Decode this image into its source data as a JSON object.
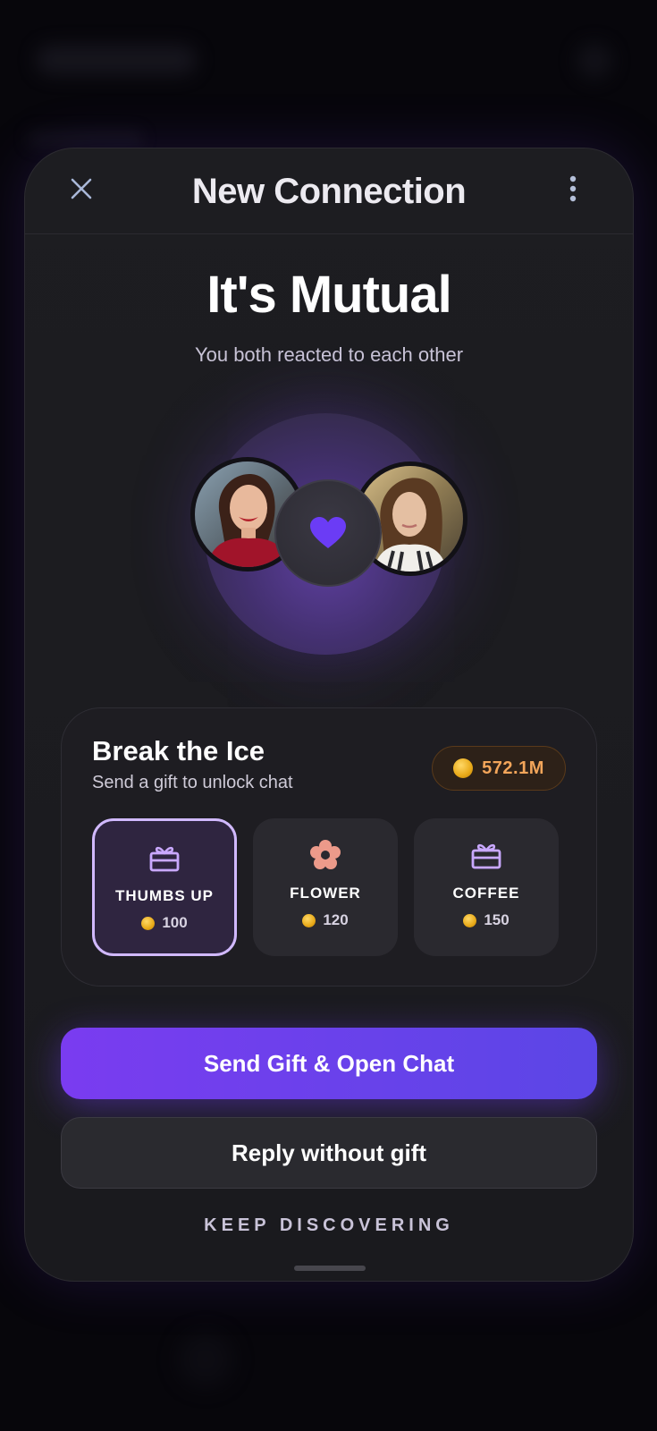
{
  "header": {
    "title": "New Connection"
  },
  "hero": {
    "title": "It's Mutual",
    "subtitle": "You both reacted to each other"
  },
  "gift_section": {
    "title": "Break the Ice",
    "subtitle": "Send a gift to unlock chat",
    "balance": "572.1M",
    "options": [
      {
        "name": "THUMBS UP",
        "price": "100",
        "icon": "gift-icon",
        "selected": true
      },
      {
        "name": "FLOWER",
        "price": "120",
        "icon": "flower-icon",
        "selected": false
      },
      {
        "name": "COFFEE",
        "price": "150",
        "icon": "gift-icon",
        "selected": false
      }
    ]
  },
  "actions": {
    "primary": "Send Gift & Open Chat",
    "secondary": "Reply without gift",
    "link": "KEEP DISCOVERING"
  },
  "colors": {
    "accent": "#7a3cf0",
    "accent_end": "#5b46e6",
    "selected_border": "#d1b9ff",
    "balance_text": "#f2a55a",
    "heart": "#6b3cf5",
    "sheet_bg": "#1d1d21"
  }
}
